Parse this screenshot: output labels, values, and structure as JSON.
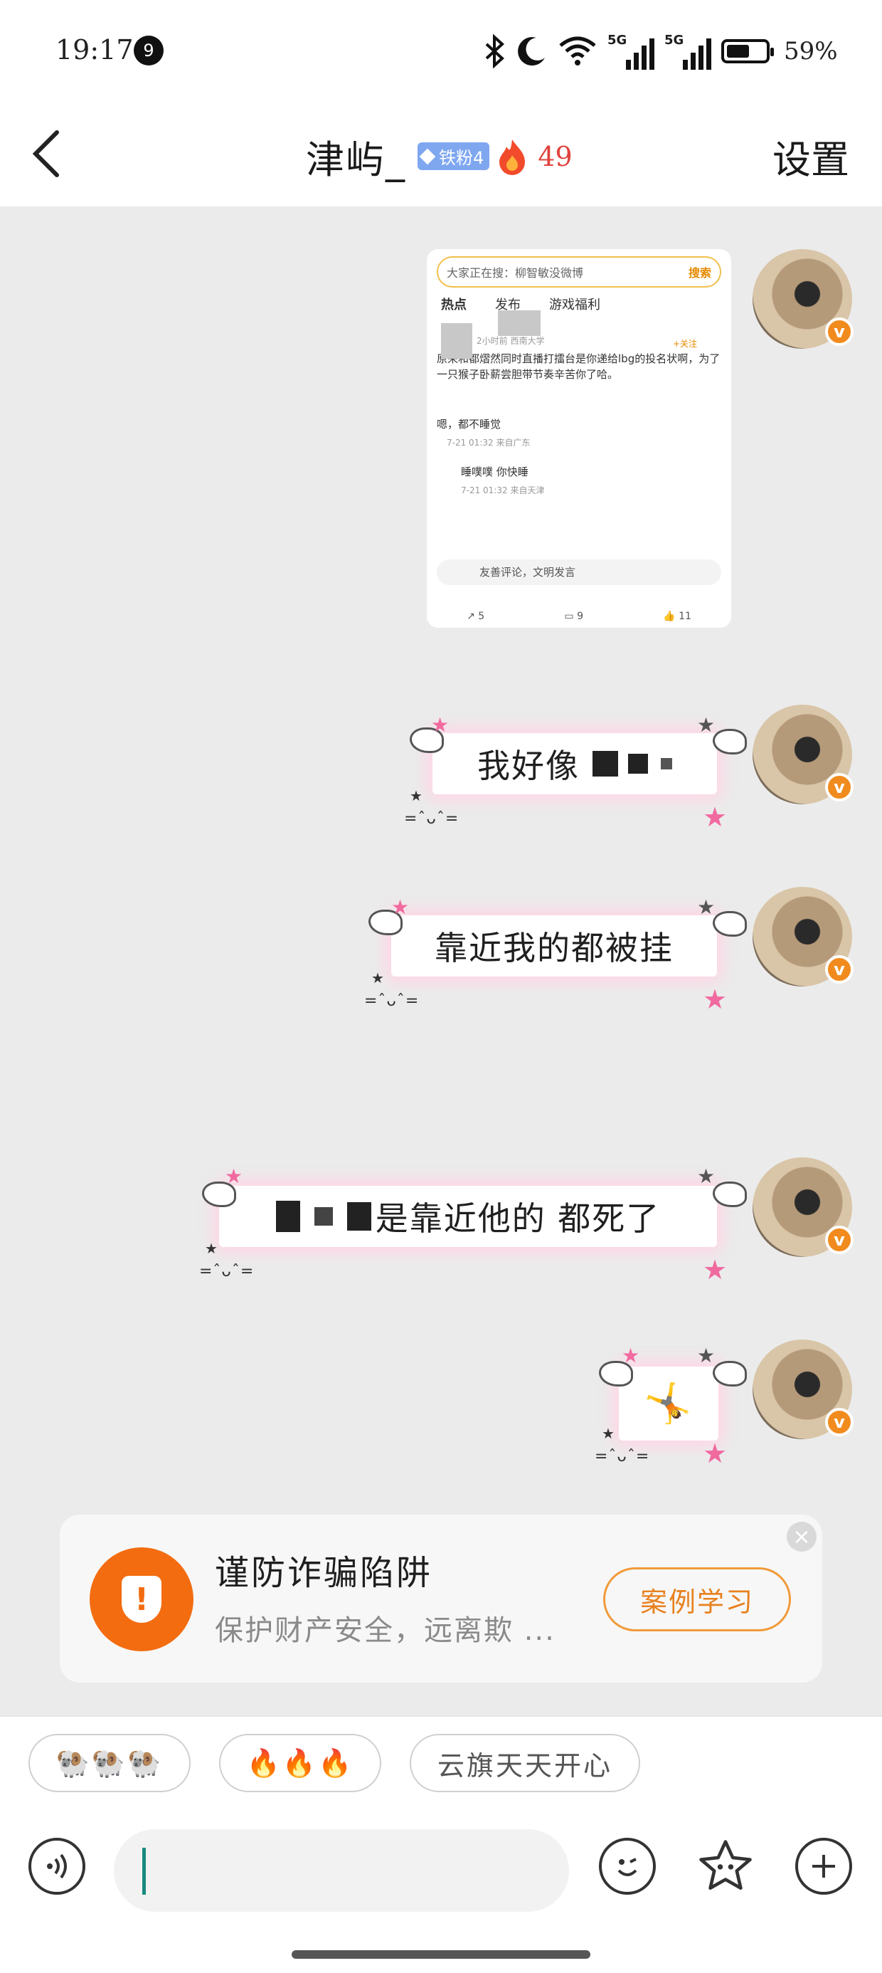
{
  "status_bar": {
    "time": "19:17",
    "notification_count": "9",
    "signal_1_label": "5G",
    "signal_2_label": "5G",
    "battery_percent": "59%",
    "battery_level": 0.59
  },
  "header": {
    "contact_name": "津屿_",
    "fan_badge": "铁粉4",
    "fire_count": "49",
    "settings_label": "设置"
  },
  "messages": {
    "image_msg": {
      "search_prompt": "大家正在搜：柳智敏没微博",
      "search_button": "搜索",
      "tab_hot": "热点",
      "tab_publish": "发布",
      "tab_welfare": "游戏福利",
      "meta": "2小时前 西南大学",
      "follow": "+关注",
      "post_text": "原来和都熠然同时直播打擂台是你递给lbg的投名状啊，为了一只猴子卧薪尝胆带节奏辛苦你了哈。",
      "comment_1": "嗯，都不睡觉",
      "comment_1_meta": "7-21 01:32 来自广东",
      "comment_2": "睡噗噗 你快睡",
      "comment_2_meta": "7-21 01:32 来自天津",
      "comment_input": "友善评论，文明发言",
      "share_count": "5",
      "comment_count": "9",
      "like_count": "11"
    },
    "msg_1_text": "我好像",
    "msg_2_text": "靠近我的都被挂",
    "msg_3_text": "是靠近他的 都死了",
    "msg_4_emoji": "🤸",
    "kaomoji": "=ˆᴗˆ="
  },
  "fraud_card": {
    "title": "谨防诈骗陷阱",
    "subtitle": "保护财产安全，远离欺 ...",
    "button": "案例学习",
    "close": "×",
    "shield_glyph": "!"
  },
  "quick_replies": [
    {
      "label": "🐏🐏🐏"
    },
    {
      "label": "🔥🔥🔥"
    },
    {
      "label": "云旗天天开心"
    }
  ],
  "input_bar": {
    "placeholder": "",
    "voice_icon": "voice-icon",
    "emoji_icon": "emoji-icon",
    "sticker_icon": "sticker-icon",
    "add_icon": "add-icon"
  },
  "colors": {
    "accent_orange": "#f36c10",
    "fire_red": "#e0413b",
    "fan_badge_blue": "#7fa7f0",
    "bubble_glow": "#ffd6e6"
  }
}
